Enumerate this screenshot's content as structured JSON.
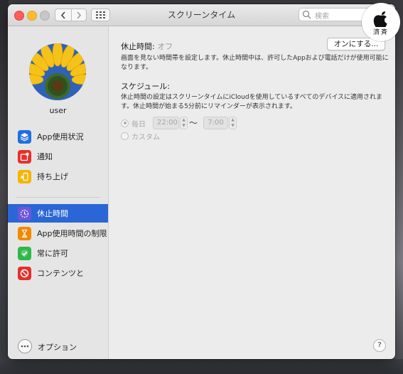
{
  "window": {
    "title": "スクリーンタイム",
    "search_placeholder": "検索"
  },
  "sidebar": {
    "username": "user",
    "items": [
      {
        "label": "App使用状況",
        "icon": "layers-icon",
        "color": "#1f6fe0"
      },
      {
        "label": "通知",
        "icon": "notification-icon",
        "color": "#e8302a"
      },
      {
        "label": "持ち上げ",
        "icon": "pickup-icon",
        "color": "#f5b400"
      },
      {
        "label": "休止時間",
        "icon": "downtime-icon",
        "color": "#6e56d8",
        "selected": true
      },
      {
        "label": "App使用時間の制限",
        "icon": "hourglass-icon",
        "color": "#f08a00"
      },
      {
        "label": "常に許可",
        "icon": "checkmark-icon",
        "color": "#2fb84a"
      },
      {
        "label": "コンテンツと",
        "icon": "restriction-icon",
        "color": "#e2302b"
      }
    ],
    "options_label": "オプション"
  },
  "content": {
    "downtime_label": "休止時間:",
    "downtime_status": "オフ",
    "turn_on_button": "オンにする...",
    "downtime_description": "画面を見ない時間帯を設定します。休止時間中は、許可したAppおよび電話だけが使用可能になります。",
    "schedule_label": "スケジュール:",
    "schedule_description": "休止時間の設定はスクリーンタイムにiCloudを使用しているすべてのデバイスに適用されます。休止時間が始まる5分前にリマインダーが表示されます。",
    "every_day_label": "毎日",
    "custom_label": "カスタム",
    "start_time": "22:00",
    "tilde": "〜",
    "end_time": "7:00",
    "help_label": "?"
  },
  "watermark": {
    "text": "濟",
    "text2": "斉"
  },
  "colors": {
    "selection": "#2a66d6",
    "window_bg": "#ececec",
    "sidebar_bg": "#e5e5e5"
  }
}
